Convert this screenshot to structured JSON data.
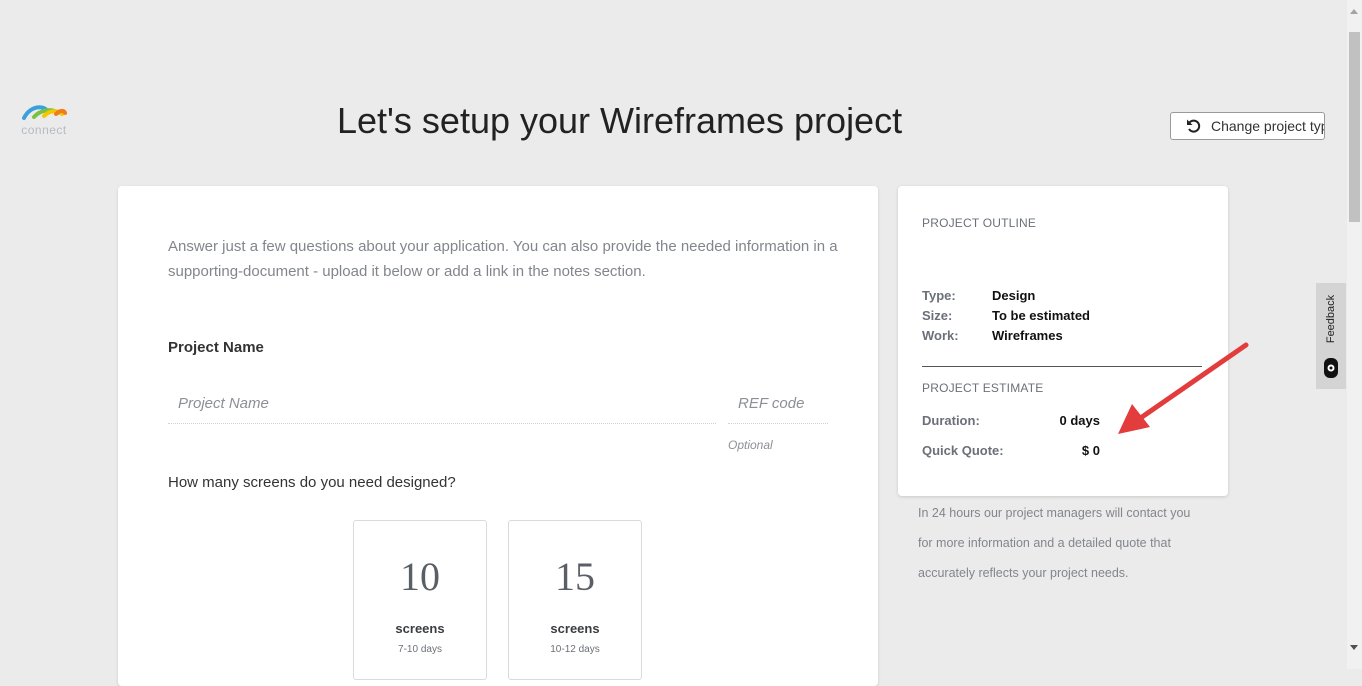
{
  "logo": {
    "text": "connect"
  },
  "header": {
    "title": "Let's setup your Wireframes project",
    "change_button_label": "Change project type"
  },
  "form": {
    "intro": "Answer just a few questions about your application. You can also provide the needed information in a supporting-document - upload it below or add a link in the notes section.",
    "project_name_label": "Project Name",
    "project_name_placeholder": "Project Name",
    "project_name_value": "",
    "ref_code_placeholder": "REF code",
    "ref_code_value": "",
    "ref_code_note": "Optional",
    "screens_question": "How many screens do you need designed?",
    "screen_options": [
      {
        "count": "10",
        "unit": "screens",
        "days": "7-10 days"
      },
      {
        "count": "15",
        "unit": "screens",
        "days": "10-12 days"
      }
    ]
  },
  "outline": {
    "title": "PROJECT OUTLINE",
    "type_label": "Type:",
    "type_value": "Design",
    "size_label": "Size:",
    "size_value": "To be estimated",
    "work_label": "Work:",
    "work_value": "Wireframes",
    "estimate_title": "PROJECT ESTIMATE",
    "duration_label": "Duration:",
    "duration_value": "0 days",
    "quote_label": "Quick Quote:",
    "quote_value": "$ 0"
  },
  "pm_note": "In 24 hours our project managers will contact you for more information and a detailed quote that accurately reflects your project needs.",
  "feedback": {
    "label": "Feedback"
  },
  "icons": {
    "logo": "connect-logo",
    "change": "undo-arrow-icon",
    "feedback": "feedback-icon",
    "annotation": "red-arrow"
  },
  "colors": {
    "background": "#ebebeb",
    "card": "#ffffff",
    "annotation_red": "#e23c3c",
    "logo_blue": "#3aa0dc",
    "logo_green": "#7ac143",
    "logo_yellow": "#f7c600",
    "logo_orange": "#f07c1b"
  }
}
